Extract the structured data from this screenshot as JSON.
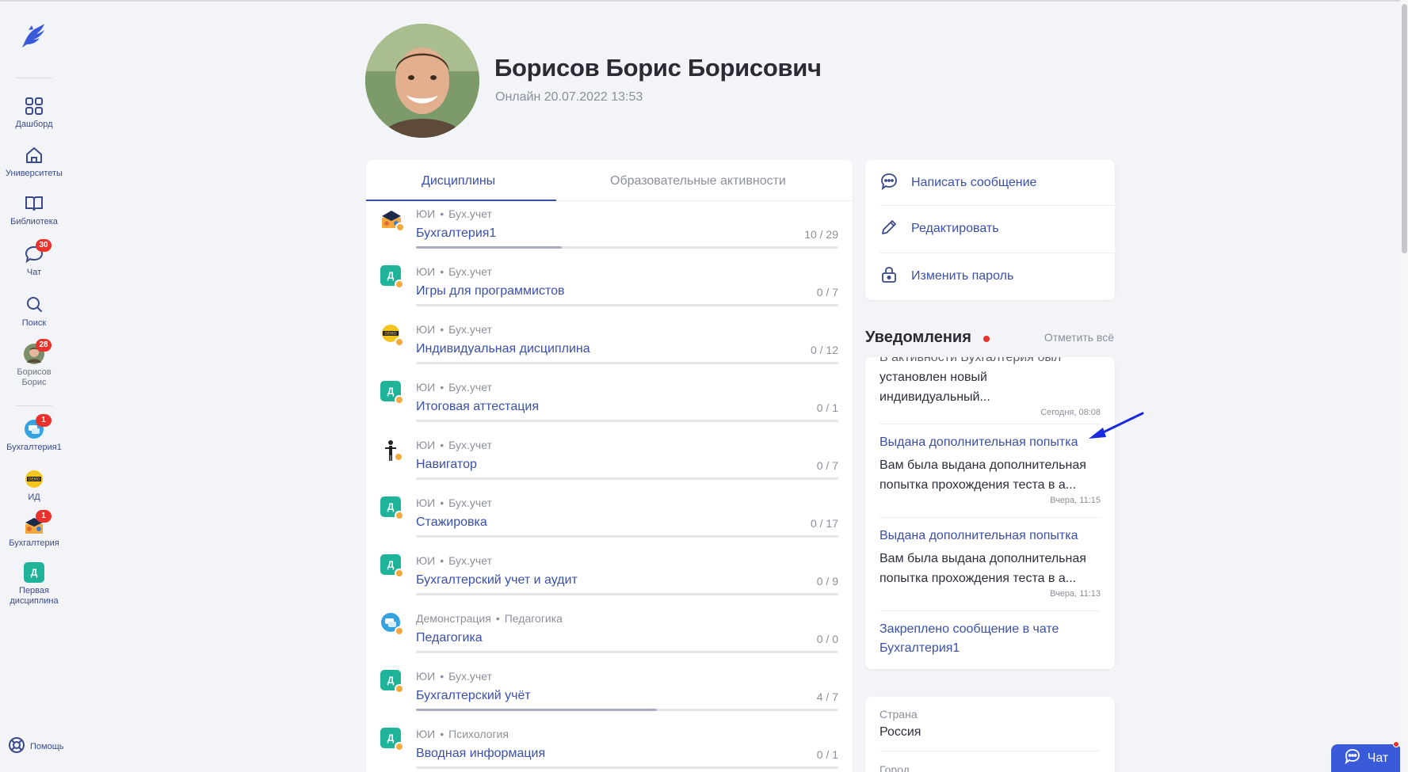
{
  "sidebar": {
    "items": [
      {
        "label": "Дашборд"
      },
      {
        "label": "Университеты"
      },
      {
        "label": "Библиотека"
      },
      {
        "label": "Чат",
        "badge": "30"
      },
      {
        "label": "Поиск"
      },
      {
        "label": "Борисов Борис",
        "badge": "28"
      },
      {
        "label": "Бухгалтерия1",
        "badge": "1"
      },
      {
        "label": "ИД"
      },
      {
        "label": "Бухгалтерия",
        "badge": "1"
      },
      {
        "label": "Первая дисциплина",
        "icon_letter": "Д"
      }
    ],
    "help_label": "Помощь"
  },
  "profile": {
    "name": "Борисов Борис Борисович",
    "online": "Онлайн 20.07.2022 13:53"
  },
  "tabs": {
    "active": "Дисциплины",
    "inactive": "Образовательные активности"
  },
  "disciplines": [
    {
      "org": "ЮИ",
      "subject": "Бух.учет",
      "title": "Бухгалтерия1",
      "count": "10 / 29",
      "progress": 0.345,
      "icon": "cap"
    },
    {
      "org": "ЮИ",
      "subject": "Бух.учет",
      "title": "Игры для программистов",
      "count": "0 / 7",
      "progress": 0,
      "icon": "letter",
      "letter": "Д"
    },
    {
      "org": "ЮИ",
      "subject": "Бух.учет",
      "title": "Индивидуальная дисциплина",
      "count": "0 / 12",
      "progress": 0,
      "icon": "demo"
    },
    {
      "org": "ЮИ",
      "subject": "Бух.учет",
      "title": "Итоговая аттестация",
      "count": "0 / 1",
      "progress": 0,
      "icon": "letter",
      "letter": "Д"
    },
    {
      "org": "ЮИ",
      "subject": "Бух.учет",
      "title": "Навигатор",
      "count": "0 / 7",
      "progress": 0,
      "icon": "figure"
    },
    {
      "org": "ЮИ",
      "subject": "Бух.учет",
      "title": "Стажировка",
      "count": "0 / 17",
      "progress": 0,
      "icon": "letter",
      "letter": "Д"
    },
    {
      "org": "ЮИ",
      "subject": "Бух.учет",
      "title": "Бухгалтерский учет и аудит",
      "count": "0 / 9",
      "progress": 0,
      "icon": "letter",
      "letter": "Д"
    },
    {
      "org": "Демонстрация",
      "subject": "Педагогика",
      "title": "Педагогика",
      "count": "0 / 0",
      "progress": 0,
      "icon": "chat"
    },
    {
      "org": "ЮИ",
      "subject": "Бух.учет",
      "title": "Бухгалтерский учёт",
      "count": "4 / 7",
      "progress": 0.571,
      "icon": "letter",
      "letter": "Д"
    },
    {
      "org": "ЮИ",
      "subject": "Психология",
      "title": "Вводная информация",
      "count": "0 / 1",
      "progress": 0,
      "icon": "letter",
      "letter": "Д"
    }
  ],
  "actions": {
    "message": "Написать сообщение",
    "edit": "Редактировать",
    "password": "Изменить пароль"
  },
  "notifications": {
    "title": "Уведомления",
    "mark_all": "Отметить всё",
    "items": [
      {
        "head": "",
        "body_top": "В активности Бухгалтерия был",
        "body": "установлен новый индивидуальный...",
        "time": "Сегодня, 08:08"
      },
      {
        "head": "Выдана дополнительная попытка",
        "body": "Вам была выдана дополнительная попытка прохождения теста в а...",
        "time": "Вчера, 11:15"
      },
      {
        "head": "Выдана дополнительная попытка",
        "body": "Вам была выдана дополнительная попытка прохождения теста в а...",
        "time": "Вчера, 11:13"
      },
      {
        "head": "Закреплено сообщение в чате Бухгалтерия1",
        "body": "",
        "time": ""
      }
    ]
  },
  "info": {
    "country_label": "Страна",
    "country_value": "Россия",
    "city_label": "Город"
  },
  "chat_button": {
    "label": "Чат"
  },
  "colors": {
    "accent": "#3a4fa8",
    "badge": "#e8322b",
    "green_icon": "#1fb39a",
    "chat_button": "#3a5bd9"
  }
}
